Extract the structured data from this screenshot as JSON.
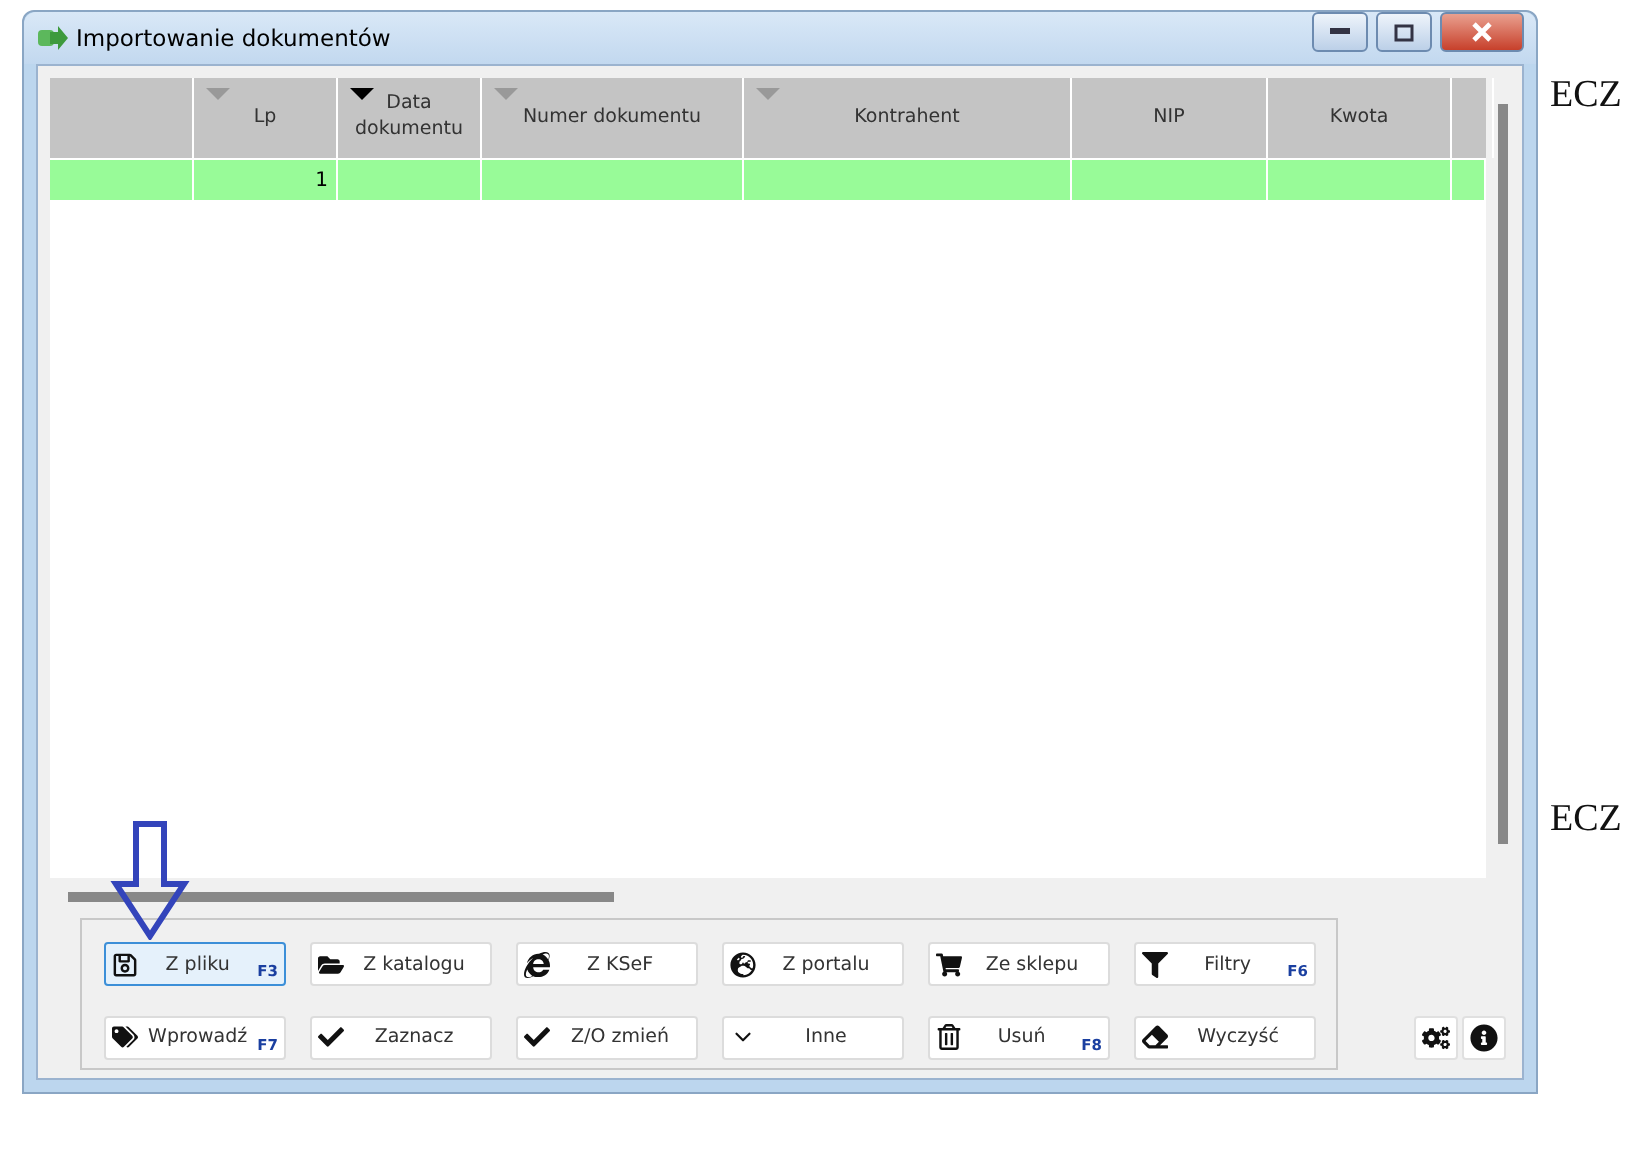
{
  "window": {
    "title": "Importowanie dokumentów"
  },
  "table": {
    "columns": [
      {},
      {
        "label": "Lp",
        "sort_active": false
      },
      {
        "label": "Data dokumentu",
        "sort_active": true
      },
      {
        "label": "Numer dokumentu",
        "sort_active": false
      },
      {
        "label": "Kontrahent",
        "sort_active": false
      },
      {
        "label": "NIP"
      },
      {
        "label": "Kwota"
      },
      {}
    ],
    "rows": [
      {
        "selected": true,
        "cells": [
          "",
          "1",
          "",
          "",
          "",
          "",
          "",
          ""
        ]
      }
    ]
  },
  "buttons": [
    {
      "label": "Z pliku",
      "kind": "save",
      "shortcut": "F3",
      "focused": true
    },
    {
      "label": "Z katalogu",
      "kind": "folder",
      "focused": false
    },
    {
      "label": "Z KSeF",
      "kind": "browser",
      "focused": false
    },
    {
      "label": "Z portalu",
      "kind": "globe",
      "focused": false
    },
    {
      "label": "Ze sklepu",
      "kind": "cart",
      "focused": false
    },
    {
      "label": "Filtry",
      "kind": "filter",
      "shortcut": "F6",
      "focused": false
    },
    {
      "label": "Wprowadź",
      "kind": "tags",
      "shortcut": "F7",
      "focused": false
    },
    {
      "label": "Zaznacz",
      "kind": "check",
      "focused": false
    },
    {
      "label": "Z/O zmień",
      "kind": "check",
      "focused": false
    },
    {
      "label": "Inne",
      "kind": "chevron",
      "focused": false
    },
    {
      "label": "Usuń",
      "kind": "trash",
      "shortcut": "F8",
      "focused": false
    },
    {
      "label": "Wyczyść",
      "kind": "eraser",
      "focused": false
    }
  ],
  "background_texts": [
    "ECZ",
    "ECZ"
  ]
}
